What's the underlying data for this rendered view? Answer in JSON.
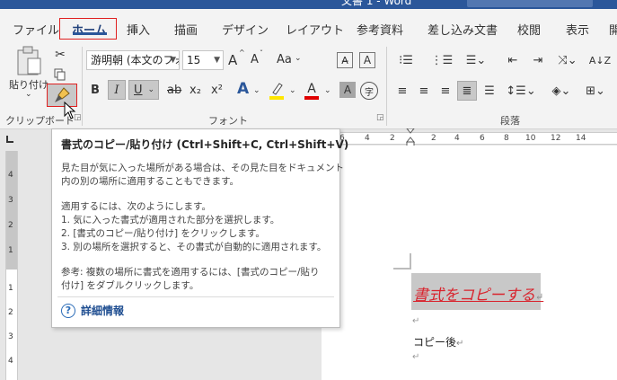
{
  "window": {
    "title_fragment": "文書 1 - Word"
  },
  "tabs": [
    {
      "label": "ファイル"
    },
    {
      "label": "ホーム"
    },
    {
      "label": "挿入"
    },
    {
      "label": "描画"
    },
    {
      "label": "デザイン"
    },
    {
      "label": "レイアウト"
    },
    {
      "label": "参考資料"
    },
    {
      "label": "差し込み文書"
    },
    {
      "label": "校閲"
    },
    {
      "label": "表示"
    },
    {
      "label": "開"
    }
  ],
  "ribbon": {
    "clipboard": {
      "paste_label": "貼り付け",
      "group_label": "クリップボード"
    },
    "font": {
      "font_name": "游明朝 (本文のフォ",
      "font_size": "15",
      "grow_label": "A",
      "shrink_label": "A",
      "case_label": "Aa",
      "bold_label": "B",
      "italic_label": "I",
      "underline_label": "U",
      "strike_label": "ab",
      "subscript_label": "x₂",
      "superscript_label": "x²",
      "effect_label": "A",
      "color_label": "A",
      "shade_label": "A",
      "enclose_label": "字",
      "group_label": "フォント",
      "underline_color": "#222222",
      "highlight_color": "#ffe600",
      "font_color": "#e00000"
    },
    "paragraph": {
      "group_label": "段落"
    }
  },
  "tooltip": {
    "title": "書式のコピー/貼り付け (Ctrl+Shift+C, Ctrl+Shift+V)",
    "lines": [
      "見た目が気に入った場所がある場合は、その見た目をドキュメント",
      "内の別の場所に適用することもできます。",
      "適用するには、次のようにします。",
      "1. 気に入った書式が適用された部分を選択します。",
      "2. [書式のコピー/貼り付け] をクリックします。",
      "3. 別の場所を選択すると、その書式が自動的に適用されます。",
      "参考: 複数の場所に書式を適用するには、[書式のコピー/貼り",
      "付け] をダブルクリックします。"
    ],
    "help_label": "詳細情報"
  },
  "ruler": {
    "h_ticks": [
      "6",
      "4",
      "2",
      "2",
      "4",
      "6",
      "8",
      "10",
      "12",
      "14"
    ],
    "v_ticks": [
      "4",
      "3",
      "2",
      "1",
      "1",
      "2",
      "3",
      "4"
    ]
  },
  "document": {
    "heading": "書式をコピーする",
    "para_mark": "↵",
    "line2": "コピー後"
  },
  "colors": {
    "accent": "#2b579a",
    "highlight_box": "#e02020",
    "heading_color": "#d9232d"
  }
}
